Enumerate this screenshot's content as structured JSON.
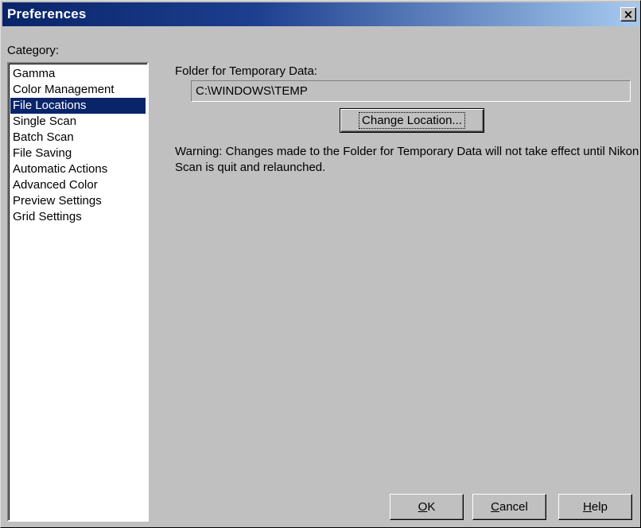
{
  "window": {
    "title": "Preferences",
    "close_glyph": "×"
  },
  "category": {
    "label": "Category:",
    "items": [
      "Gamma",
      "Color Management",
      "File Locations",
      "Single Scan",
      "Batch Scan",
      "File Saving",
      "Automatic Actions",
      "Advanced Color",
      "Preview Settings",
      "Grid Settings"
    ],
    "selected": "File Locations"
  },
  "file_locations": {
    "folder_label": "Folder for Temporary Data:",
    "folder_value": "C:\\WINDOWS\\TEMP",
    "change_button": "Change Location...",
    "warning": "Warning: Changes made to the Folder for Temporary Data will not take effect until Nikon Scan is quit and relaunched."
  },
  "buttons": {
    "ok_accel": "O",
    "ok_rest": "K",
    "cancel_accel": "C",
    "cancel_rest": "ancel",
    "help_accel": "H",
    "help_rest": "elp"
  },
  "colors": {
    "dialog_face": "#c0c0c0",
    "title_active": "#0a246a",
    "selection": "#0a246a"
  },
  "icons": {
    "close": "close-icon"
  }
}
